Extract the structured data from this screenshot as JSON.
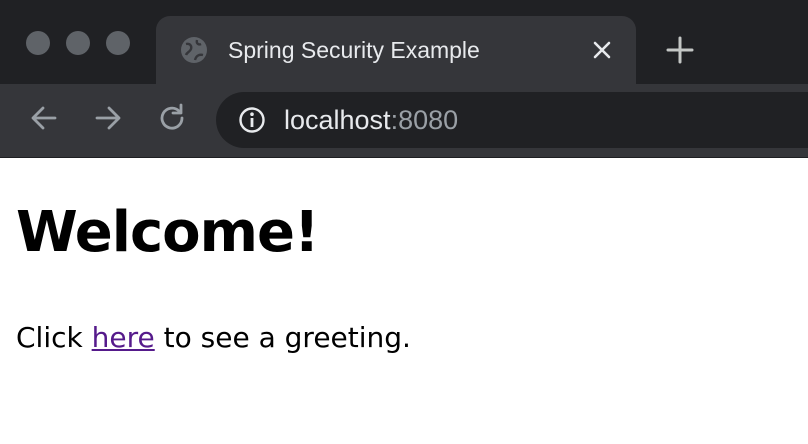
{
  "window": {
    "controls": [
      "close",
      "minimize",
      "zoom"
    ]
  },
  "tab": {
    "title": "Spring Security Example",
    "favicon": "globe-icon",
    "close_icon": "close-icon"
  },
  "new_tab_icon": "plus-icon",
  "toolbar": {
    "back_icon": "arrow-left-icon",
    "forward_icon": "arrow-right-icon",
    "reload_icon": "reload-icon",
    "site_info_icon": "info-icon",
    "url_host": "localhost",
    "url_port": ":8080"
  },
  "page": {
    "heading": "Welcome!",
    "text_before": "Click ",
    "link_text": "here",
    "text_after": " to see a greeting."
  },
  "colors": {
    "chrome_dark": "#202124",
    "chrome_toolbar": "#35363a",
    "visited_link": "#551a8b"
  }
}
